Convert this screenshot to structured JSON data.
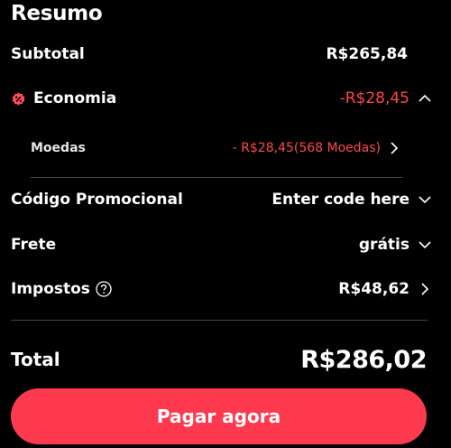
{
  "summary": {
    "title": "Resumo",
    "subtotal": {
      "label": "Subtotal",
      "value": "R$265,84"
    },
    "economia": {
      "label": "Economia",
      "value": "-R$28,45",
      "icon": "discount-icon"
    },
    "moedas": {
      "label": "Moedas",
      "value": "- R$28,45(568 Moedas)"
    },
    "promo": {
      "label": "Código Promocional",
      "value": "Enter code here"
    },
    "frete": {
      "label": "Frete",
      "value": "grátis"
    },
    "impostos": {
      "label": "Impostos",
      "value": "R$48,62"
    },
    "total": {
      "label": "Total",
      "value": "R$286,02"
    }
  },
  "pay_button": {
    "label": "Pagar agora"
  },
  "colors": {
    "background": "#000000",
    "discount_red": "#ff4747",
    "button": "#ff3a4f",
    "divider": "#444444"
  }
}
